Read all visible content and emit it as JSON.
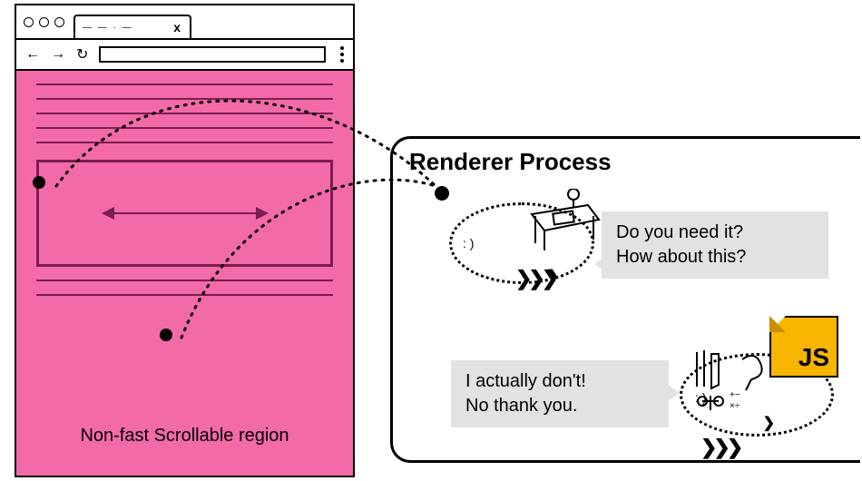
{
  "browser": {
    "tab_placeholder": "— — · —",
    "tab_close": "x",
    "region_label": "Non-fast Scrollable region"
  },
  "renderer": {
    "title": "Renderer Process",
    "bubble1_line1": "Do you need it?",
    "bubble1_line2": "How about this?",
    "bubble2_line1": "I actually don't!",
    "bubble2_line2": "No thank you."
  },
  "js_badge": "JS",
  "icons": {
    "back": "←",
    "forward": "→",
    "reload": "↻",
    "chevrons": "❯❯❯",
    "chevron_sm": "❯",
    "face": ":  )"
  }
}
